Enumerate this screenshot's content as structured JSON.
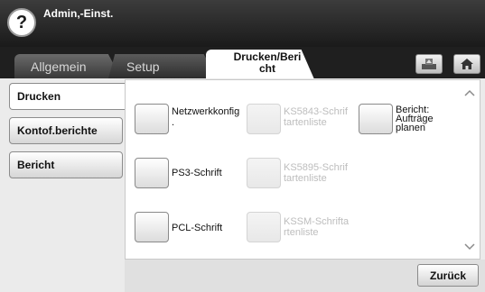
{
  "header": {
    "help_glyph": "?",
    "title": "Admin,-Einst."
  },
  "tabs": [
    {
      "label": "Allgemein"
    },
    {
      "label": "Setup"
    },
    {
      "label_line1": "Drucken/Beri",
      "label_line2": "cht"
    }
  ],
  "header_icons": {
    "tray_icon": "tray-icon",
    "home_icon": "home-icon"
  },
  "sidebar": {
    "items": [
      {
        "label": "Drucken",
        "active": true
      },
      {
        "label": "Kontof.berichte",
        "active": false
      },
      {
        "label": "Bericht",
        "active": false
      }
    ]
  },
  "options": {
    "netz": {
      "line1": "Netzwerkkonfig",
      "line2": "."
    },
    "ks5843": {
      "line1": "KS5843-Schrif",
      "line2": "tartenliste"
    },
    "bericht": {
      "line1": "Bericht:",
      "line2": "Aufträge",
      "line3": "planen"
    },
    "ps3": {
      "line1": "PS3-Schrift"
    },
    "ks5895": {
      "line1": "KS5895-Schrif",
      "line2": "tartenliste"
    },
    "pcl": {
      "line1": "PCL-Schrift"
    },
    "kssm": {
      "line1": "KSSM-Schrifta",
      "line2": "rtenliste"
    }
  },
  "scroll": {
    "up": "^",
    "down": "v"
  },
  "footer": {
    "back_label": "Zurück"
  }
}
